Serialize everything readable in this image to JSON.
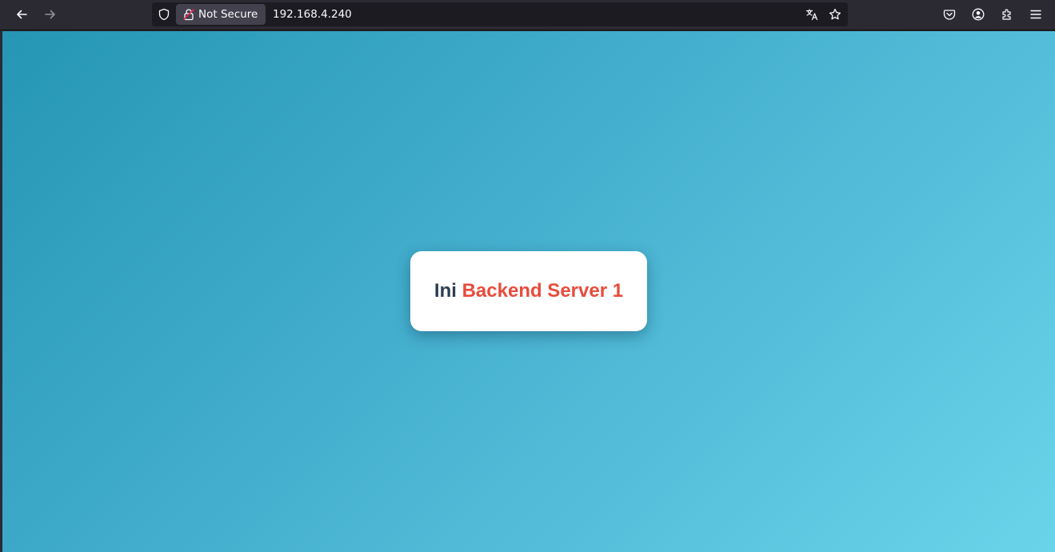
{
  "browser": {
    "security_label": "Not Secure",
    "url": "192.168.4.240",
    "icons": {
      "back": "back-arrow-icon",
      "forward": "forward-arrow-icon",
      "shield": "tracking-protection-shield-icon",
      "lock": "insecure-lock-icon",
      "translate": "translate-icon",
      "bookmark": "star-icon",
      "pocket": "pocket-icon",
      "account": "account-icon",
      "extensions": "extensions-icon",
      "menu": "hamburger-menu-icon"
    }
  },
  "page": {
    "heading_prefix": "Ini",
    "heading_highlight": "Backend Server 1",
    "colors": {
      "prefix": "#2c3e50",
      "highlight": "#e74c3c",
      "background_start": "#2596b4",
      "background_end": "#6ad4ea",
      "card": "#ffffff"
    }
  }
}
